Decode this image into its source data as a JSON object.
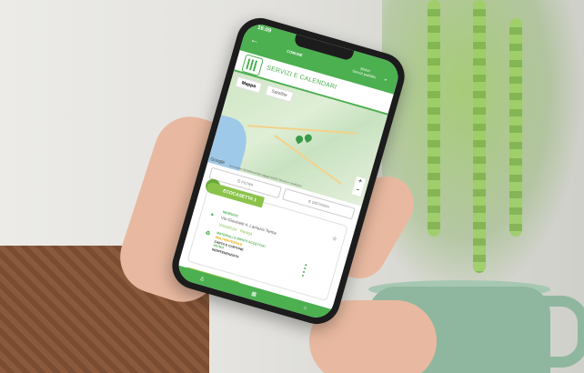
{
  "status": {
    "time": "16:09"
  },
  "app": {
    "comune_label": "COMUNE",
    "right_title": "Maiori",
    "right_subtitle": "Servizi pubblici",
    "section_title": "SERVIZI E CALENDARI"
  },
  "map": {
    "tab_map": "Mappa",
    "tab_satellite": "Satellite",
    "zoom_in": "+",
    "zoom_out": "−",
    "google": "Google",
    "copyright": "Scorciatoie da tastiera  Dati mappa ©2022  Termini e condizioni"
  },
  "filters": {
    "filter_label": "FILTRA",
    "distance_label": "DISTANZA"
  },
  "card": {
    "title": "ECOCASETTA 1",
    "address_label": "INDIRIZZO",
    "address": "Via Giovinetti 4, Lamezia Terme",
    "link_view": "Visualizza",
    "link_nav": "Naviga",
    "materials_label": "MATERIALI E RIFIUTI ACCETTATI",
    "materials": [
      "MULTIMATERIALE",
      "CARTA E CARTONE",
      "VETRO",
      "INDIFFERENZIATA"
    ]
  },
  "card2": {
    "title": "ECOCASETTA 2"
  },
  "icons": [
    "back-arrow-icon",
    "chevron-down-icon",
    "map-pin-icon",
    "filter-icon",
    "distance-icon",
    "star-icon",
    "location-icon",
    "recycle-icon",
    "user-icon",
    "calendar-icon",
    "home-icon"
  ]
}
